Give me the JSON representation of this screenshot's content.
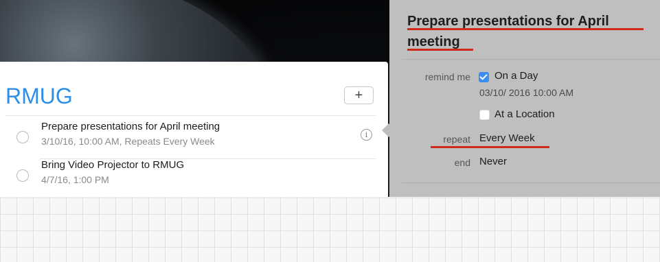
{
  "list": {
    "title": "RMUG",
    "add_label": "+",
    "reminders": [
      {
        "title": "Prepare presentations for April meeting",
        "subtitle": "3/10/16, 10:00 AM, Repeats Every Week",
        "info_icon": "info-icon"
      },
      {
        "title": "Bring Video Projector to RMUG",
        "subtitle": "4/7/16, 1:00 PM"
      }
    ]
  },
  "detail": {
    "title": "Prepare presentations for April meeting",
    "remind_me_label": "remind me",
    "on_a_day_label": "On a Day",
    "on_a_day_checked": true,
    "date_value": "03/10/ 2016 10:00 AM",
    "at_location_label": "At a Location",
    "at_location_checked": false,
    "repeat_label": "repeat",
    "repeat_value": "Every Week",
    "end_label": "end",
    "end_value": "Never"
  },
  "colors": {
    "accent": "#2b8ee8",
    "checkbox_blue": "#3b8df0",
    "annotation_red": "#cd2a1b",
    "detail_bg": "#bfbfbf"
  }
}
